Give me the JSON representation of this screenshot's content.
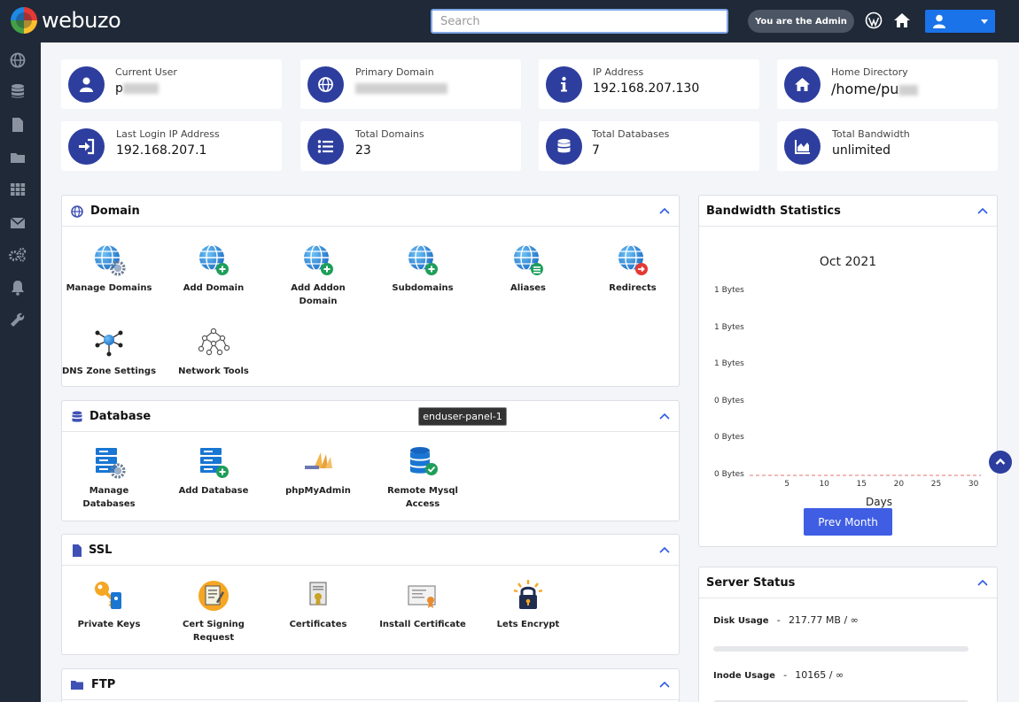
{
  "brand": {
    "name": "webuzo"
  },
  "search": {
    "placeholder": "Search"
  },
  "topbar": {
    "admin_label": "You are the Admin"
  },
  "info_cards": [
    {
      "label": "Current User",
      "value": "p"
    },
    {
      "label": "Primary Domain",
      "value": ""
    },
    {
      "label": "IP Address",
      "value": "192.168.207.130"
    },
    {
      "label": "Home Directory",
      "value": "/home/pu"
    },
    {
      "label": "Last Login IP Address",
      "value": "192.168.207.1"
    },
    {
      "label": "Total Domains",
      "value": "23"
    },
    {
      "label": "Total Databases",
      "value": "7"
    },
    {
      "label": "Total Bandwidth",
      "value": "unlimited"
    }
  ],
  "domain_panel": {
    "title": "Domain",
    "items": [
      {
        "label": "Manage Domains",
        "icon": "globe-gear-icon"
      },
      {
        "label": "Add Domain",
        "icon": "globe-plus-icon"
      },
      {
        "label": "Add Addon Domain",
        "icon": "globe-plus-icon"
      },
      {
        "label": "Subdomains",
        "icon": "globe-plus-icon"
      },
      {
        "label": "Aliases",
        "icon": "globe-list-icon"
      },
      {
        "label": "Redirects",
        "icon": "globe-redirect-icon"
      },
      {
        "label": "DNS Zone Settings",
        "icon": "dns-network-icon"
      },
      {
        "label": "Network Tools",
        "icon": "network-nodes-icon"
      }
    ]
  },
  "database_panel": {
    "title": "Database",
    "tooltip": "enduser-panel-1",
    "items": [
      {
        "label": "Manage Databases",
        "icon": "database-gear-icon"
      },
      {
        "label": "Add Database",
        "icon": "database-plus-icon"
      },
      {
        "label": "phpMyAdmin",
        "icon": "phpmyadmin-icon"
      },
      {
        "label": "Remote Mysql Access",
        "icon": "database-remote-icon"
      }
    ]
  },
  "ssl_panel": {
    "title": "SSL",
    "items": [
      {
        "label": "Private Keys",
        "icon": "key-icon"
      },
      {
        "label": "Cert Signing Request",
        "icon": "cert-request-icon"
      },
      {
        "label": "Certificates",
        "icon": "certificate-icon"
      },
      {
        "label": "Install Certificate",
        "icon": "install-certificate-icon"
      },
      {
        "label": "Lets Encrypt",
        "icon": "padlock-icon"
      }
    ]
  },
  "ftp_panel": {
    "title": "FTP"
  },
  "bandwidth": {
    "title": "Bandwidth Statistics",
    "prev_button": "Prev Month"
  },
  "chart_data": {
    "type": "line",
    "title": "Oct 2021",
    "xlabel": "Days",
    "ylabel": "",
    "y_tick_labels": [
      "1 Bytes",
      "1 Bytes",
      "1 Bytes",
      "0 Bytes",
      "0 Bytes",
      "0 Bytes"
    ],
    "x_ticks": [
      5,
      10,
      15,
      20,
      25,
      30
    ],
    "xlim": [
      0,
      31
    ],
    "ylim": [
      0,
      1
    ],
    "series": [
      {
        "values": [
          0,
          0,
          0,
          0,
          0,
          0,
          0,
          0,
          0,
          0,
          0,
          0,
          0,
          0,
          0,
          0,
          0,
          0,
          0,
          0,
          0,
          0,
          0,
          0,
          0,
          0,
          0,
          0,
          0,
          0,
          0
        ],
        "color": "#e57373",
        "style": "dashed"
      }
    ]
  },
  "server_status": {
    "title": "Server Status",
    "rows": [
      {
        "label": "Disk Usage",
        "value": "217.77 MB / ∞"
      },
      {
        "label": "Inode Usage",
        "value": "10165 / ∞"
      }
    ]
  },
  "colors": {
    "sidebar": "#1f2937",
    "accent": "#2d3e9e",
    "button": "#3f5ee3"
  }
}
